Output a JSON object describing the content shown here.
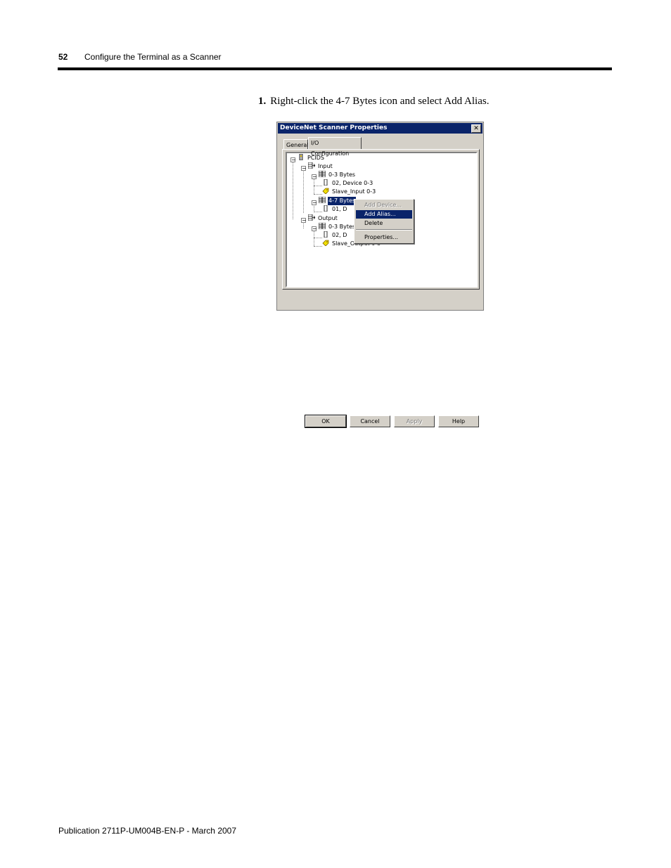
{
  "header": {
    "page_number": "52",
    "chapter_title": "Configure the Terminal as a Scanner"
  },
  "step": {
    "number": "1.",
    "text": "Right-click the 4-7 Bytes icon and select Add Alias."
  },
  "dialog": {
    "title": "DeviceNet Scanner Properties",
    "close_label": "✕",
    "tabs": {
      "general": "General",
      "io": "I/O Configuration"
    },
    "tree": {
      "root": "PCIDS",
      "input": "Input",
      "in_03": "0-3 Bytes",
      "in_03_dev": "02, Device 0-3",
      "in_03_alias": "Slave_Input 0-3",
      "in_47": "4-7 Bytes",
      "in_47_dev": "01, D",
      "output": "Output",
      "out_03": "0-3 Bytes",
      "out_03_dev": "02, D",
      "out_03_alias": "Slave_Output 0-3"
    },
    "buttons": {
      "ok": "OK",
      "cancel": "Cancel",
      "apply": "Apply",
      "help": "Help"
    }
  },
  "context_menu": {
    "add_device": "Add Device...",
    "add_alias": "Add Alias...",
    "delete": "Delete",
    "properties": "Properties..."
  },
  "footer": {
    "publication": "Publication 2711P-UM004B-EN-P - March 2007"
  }
}
